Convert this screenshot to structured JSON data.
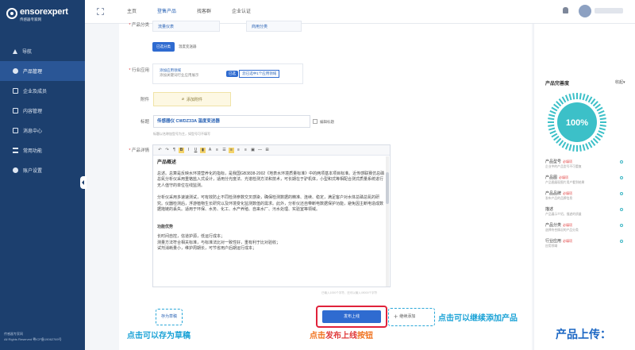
{
  "sidebar": {
    "brand": "ensorexpert",
    "brand_sub": "传感器专家网",
    "items": [
      {
        "label": "导航",
        "icon": "navigation-icon"
      },
      {
        "label": "产品管理",
        "icon": "product-icon",
        "active": true
      },
      {
        "label": "企业及成员",
        "icon": "team-icon"
      },
      {
        "label": "内容管理",
        "icon": "content-icon"
      },
      {
        "label": "消息中心",
        "icon": "message-icon"
      },
      {
        "label": "常用功能",
        "icon": "tools-icon"
      },
      {
        "label": "账户设置",
        "icon": "settings-icon"
      }
    ],
    "footer_line1": "传感器专家网",
    "footer_line2": "All Rights Reserved 粤ICP备19062769号"
  },
  "topbar": {
    "tabs": [
      "主页",
      "登售产品",
      "找客群",
      "企业认证"
    ],
    "active_tab": 1
  },
  "form": {
    "category_label": "产品分类",
    "category_option_1": "流量仪表",
    "category_option_2": "商用分类",
    "selected_btn": "已选分类",
    "selected_text": "温度变送器",
    "industry_label": "行业应用",
    "industry_hint_1": "添加应用领域",
    "industry_hint_2": "添加关键词行业应用展示",
    "industry_toggle": "已选",
    "industry_toggle_note": "您已选中1个应用领域",
    "attach_label": "附件",
    "attach_btn": "添加附件",
    "title_label": "标题",
    "title_value": "传感器仪 CWDZ33A 温度变送器",
    "title_hint": "标题以名称加型号为主，如型号可不填写",
    "title_checkbox": "编辑标题",
    "detail_label": "产品详情",
    "char_count": "已输入1000个字符，还可以输入49000个字符"
  },
  "editor": {
    "heading": "产品概述",
    "p1": "总述。总算是反映水环境营养化的指标，是我国GB3838-2002《地表水环境质量标准》中的两项基本项目标准。近传感联赛仿总磷总氮分析仪采用重铬盐入式设计，适用分光度法、光谱检测方法和技术，可长期在于驴机体，小型和式等相配合测式质量系统进行无人值守的单位在线监测。",
    "p2": "分析仪采用多速速测试，可有效防止不同检测参数交叉感染，确保检测数据的精准、连续、稳定，满足客户对水体总磷总氮的研究。仪器检测后，浮游植物生长研究以及环境变化监测数值的需求。此外，分析仪还自带断电数据保护功能，避免因主断电造成数据拖链的丢失。适用于环保、水务、化工、水产养殖、自来水厂、污水处理、实验室等领域。",
    "heading2": "功能优势",
    "b1": "长时间自控，信道护源，低运行成本；",
    "b2": "测量方法符合相关标准，与标准法比对一致性好，重有利于比对验收；",
    "b3": "试剂消耗量小，维护周期长，可节省用户后期运行成本；"
  },
  "buttons": {
    "draft": "存为草稿",
    "publish": "发布上线",
    "add": "继续添加"
  },
  "right_panel": {
    "title": "产品完善度",
    "collapse": "收起",
    "percent": 100,
    "percent_label": "100%",
    "items": [
      {
        "name": "产品型号",
        "badge": "必填项",
        "desc": "企业中的产品型号不可重复"
      },
      {
        "name": "产品图",
        "badge": "必填项",
        "desc": "产品图展现图片用户看到结果"
      },
      {
        "name": "产品品牌",
        "badge": "必填项",
        "desc": "发布产品的品牌信息"
      },
      {
        "name": "描述",
        "badge": "",
        "desc": "产品展示介绍，描述的质量"
      },
      {
        "name": "产品分类",
        "badge": "必填项",
        "desc": "选择符合情况的产品分类"
      },
      {
        "name": "行业应用",
        "badge": "必填项",
        "desc": "应用领域"
      }
    ]
  },
  "annotations": {
    "draft": "点击可以存为草稿",
    "publish_prefix": "点击",
    "publish_highlight": "发布上线",
    "publish_suffix": "按钮",
    "add": "点击可以继续添加产品",
    "title": "产品上传："
  },
  "colors": {
    "sidebar": "#1c3f6e",
    "accent": "#2f6bd0",
    "gauge": "#3cc0c8",
    "highlight_border": "#e0223a"
  }
}
